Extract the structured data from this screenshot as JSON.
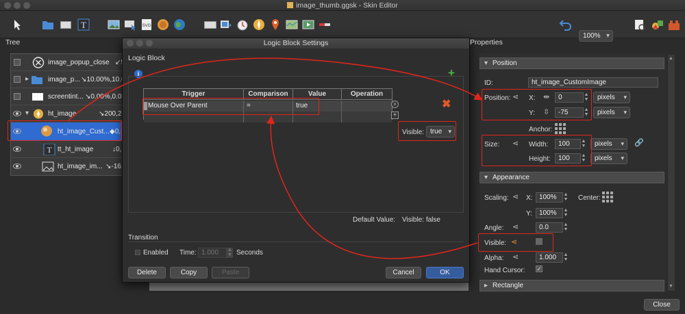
{
  "window": {
    "title": "image_thumb.ggsk - Skin Editor"
  },
  "toolbar": {
    "zoom": "100%"
  },
  "tree": {
    "title": "Tree",
    "rows": [
      {
        "name": "image_popup_close",
        "value": "↙5"
      },
      {
        "name": "image_p...",
        "value": "↘10.00%,10.00"
      },
      {
        "name": "screentint...",
        "value": "↘0.00%,0.00%"
      },
      {
        "name": "ht_image",
        "value": "↘200,2"
      },
      {
        "name": "ht_image_Cust...",
        "value": "◆0,-"
      },
      {
        "name": "tt_ht_image",
        "value": "↓0,"
      },
      {
        "name": "ht_image_im...",
        "value": "↘-16,-"
      }
    ]
  },
  "dialog": {
    "title": "Logic Block Settings",
    "section": "Logic Block",
    "columns": [
      "Trigger",
      "Comparison",
      "Value",
      "Operation"
    ],
    "row": {
      "trigger": "Mouse Over Parent",
      "comparison": "=",
      "value": "true",
      "operation": ""
    },
    "visible_label": "Visible:",
    "visible_value": "true",
    "default_label": "Default Value:",
    "default_visible": "Visible: false",
    "transition": {
      "title": "Transition",
      "enabled": "Enabled",
      "time_label": "Time:",
      "time_value": "1.000",
      "seconds": "Seconds"
    },
    "buttons": {
      "delete": "Delete",
      "copy": "Copy",
      "paste": "Paste",
      "cancel": "Cancel",
      "ok": "OK"
    }
  },
  "properties": {
    "title": "Properties",
    "position_section": "Position",
    "id_label": "ID:",
    "id_value": "ht_image_CustomImage",
    "position_label": "Position:",
    "x_label": "X:",
    "x_value": "0",
    "y_label": "Y:",
    "y_value": "-75",
    "unit": "pixels",
    "anchor_label": "Anchor:",
    "size_label": "Size:",
    "width_label": "Width:",
    "width_value": "100",
    "height_label": "Height:",
    "height_value": "100",
    "appearance_section": "Appearance",
    "scaling_label": "Scaling:",
    "scale_x": "100%",
    "scale_y": "100%",
    "center_label": "Center:",
    "angle_label": "Angle:",
    "angle_value": "0.0",
    "visible_label": "Visible:",
    "alpha_label": "Alpha:",
    "alpha_value": "1.000",
    "hand_cursor_label": "Hand Cursor:",
    "rectangle_section": "Rectangle"
  },
  "footer": {
    "close": "Close"
  },
  "colors": {
    "selection": "#2f6bd0",
    "annotation": "#e0261b",
    "ok_button": "#355d9e"
  }
}
